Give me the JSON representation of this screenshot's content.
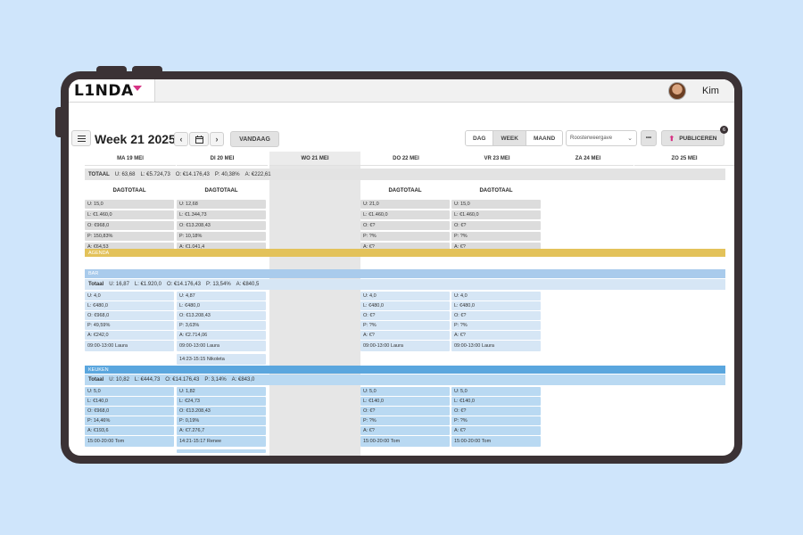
{
  "app": {
    "logo": "L1NDA",
    "user_name": "Kim"
  },
  "toolbar": {
    "title": "Week 21 2025",
    "today_label": "VANDAAG",
    "views": [
      "DAG",
      "WEEK",
      "MAAND"
    ],
    "active_view": "WEEK",
    "view_select": "Roosterweergave",
    "more_label": "•••",
    "publish_label": "PUBLICEREN",
    "publish_badge": "6"
  },
  "days": [
    "MA 19 MEI",
    "DI 20 MEI",
    "WO 21 MEI",
    "DO 22 MEI",
    "VR 23 MEI",
    "ZA 24 MEI",
    "ZO 25 MEI"
  ],
  "totaal": {
    "label": "TOTAAL",
    "items": [
      "U: 63,68",
      "L: €5.724,73",
      "O: €14.176,43",
      "P: 40,38%",
      "A: €222,61"
    ]
  },
  "dagtotaal": {
    "label": "DAGTOTAAL",
    "columns": [
      [
        "U: 15,0",
        "L: €1.460,0",
        "O: €968,0",
        "P: 150,83%",
        "A: €64,53"
      ],
      [
        "U: 12,68",
        "L: €1.344,73",
        "O: €13.208,43",
        "P: 10,18%",
        "A: €1.041,4"
      ],
      null,
      [
        "U: 21,0",
        "L: €1.460,0",
        "O: €?",
        "P: ?%",
        "A: €?"
      ],
      [
        "U: 15,0",
        "L: €1.460,0",
        "O: €?",
        "P: ?%",
        "A: €?"
      ]
    ]
  },
  "agenda_label": "AGENDA",
  "bar": {
    "label": "BAR",
    "totaal": [
      "Totaal",
      "U: 16,87",
      "L: €1.920,0",
      "O: €14.176,43",
      "P: 13,54%",
      "A: €840,5"
    ],
    "columns": [
      [
        "U: 4,0",
        "L: €480,0",
        "O: €968,0",
        "P: 49,59%",
        "A: €242,0"
      ],
      [
        "U: 4,87",
        "L: €480,0",
        "O: €13.208,43",
        "P: 3,63%",
        "A: €2.714,06"
      ],
      null,
      [
        "U: 4,0",
        "L: €480,0",
        "O: €?",
        "P: ?%",
        "A: €?"
      ],
      [
        "U: 4,0",
        "L: €480,0",
        "O: €?",
        "P: ?%",
        "A: €?"
      ]
    ],
    "shifts": [
      [
        "09:00-13:00 Laura"
      ],
      [
        "09:00-13:00 Laura",
        "14:23-15:15 Nikoleta"
      ],
      null,
      [
        "09:00-13:00 Laura"
      ],
      [
        "09:00-13:00 Laura"
      ]
    ]
  },
  "keuken": {
    "label": "KEUKEN",
    "totaal": [
      "Totaal",
      "U: 10,82",
      "L: €444,73",
      "O: €14.176,43",
      "P: 3,14%",
      "A: €843,0"
    ],
    "columns": [
      [
        "U: 5,0",
        "L: €140,0",
        "O: €968,0",
        "P: 14,46%",
        "A: €193,6"
      ],
      [
        "U: 1,82",
        "L: €24,73",
        "O: €13.208,43",
        "P: 0,19%",
        "A: €7.276,7"
      ],
      null,
      [
        "U: 5,0",
        "L: €140,0",
        "O: €?",
        "P: ?%",
        "A: €?"
      ],
      [
        "U: 5,0",
        "L: €140,0",
        "O: €?",
        "P: ?%",
        "A: €?"
      ]
    ],
    "shifts": [
      [
        "15:00-20:00 Tom"
      ],
      [
        "14:21-15:17 Renee"
      ],
      null,
      [
        "15:00-20:00 Tom"
      ],
      [
        "15:00-20:00 Tom"
      ]
    ]
  },
  "colors": {
    "frame": "#3b3235",
    "accent": "#d63384",
    "agenda": "#e3c25a",
    "bar": "#a9cbec",
    "keuken": "#5aa6de"
  }
}
